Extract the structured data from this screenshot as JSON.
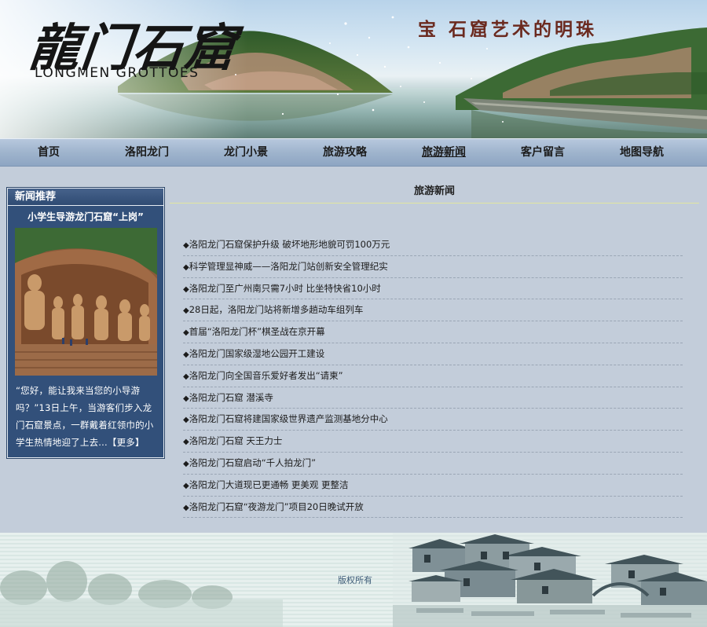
{
  "banner": {
    "logo_cn": "龍门石窟",
    "logo_en": "LONGMEN GROTTOES",
    "slogan": "宝 石窟艺术的明珠"
  },
  "nav": {
    "items": [
      {
        "label": "首页"
      },
      {
        "label": "洛阳龙门"
      },
      {
        "label": "龙门小景"
      },
      {
        "label": "旅游攻略"
      },
      {
        "label": "旅游新闻"
      },
      {
        "label": "客户留言"
      },
      {
        "label": "地图导航"
      }
    ],
    "active_index": 4
  },
  "sidebar": {
    "header": "新闻推荐",
    "title": "小学生导游龙门石窟“上岗”",
    "text": "“您好，能让我来当您的小导游吗？”13日上午，当游客们步入龙门石窟景点，一群戴着红领巾的小学生热情地迎了上去...",
    "more": "【更多】"
  },
  "main": {
    "title": "旅游新闻",
    "bullet": "◆",
    "news": [
      "洛阳龙门石窟保护升级 破坏地形地貌可罚100万元",
      "科学管理显神威——洛阳龙门站创新安全管理纪实",
      "洛阳龙门至广州南只需7小时 比坐特快省10小时",
      "28日起，洛阳龙门站将新增多趟动车组列车",
      "首届“洛阳龙门杯”棋圣战在京开幕",
      "洛阳龙门国家级湿地公园开工建设",
      "洛阳龙门向全国音乐爱好者发出“请柬”",
      "洛阳龙门石窟 潜溪寺",
      "洛阳龙门石窟将建国家级世界遗产监测基地分中心",
      "洛阳龙门石窟 天王力士",
      "洛阳龙门石窟启动“千人拍龙门”",
      "洛阳龙门大道现已更通畅 更美观 更整洁",
      "洛阳龙门石窟“夜游龙门”项目20日晚试开放"
    ]
  },
  "footer": {
    "copyright": "版权所有"
  },
  "colors": {
    "page_bg": "#c3cdda",
    "nav_bg": "#9fb4cd",
    "sidebar_bg": "#32507a",
    "slogan": "#6b2a1f"
  }
}
